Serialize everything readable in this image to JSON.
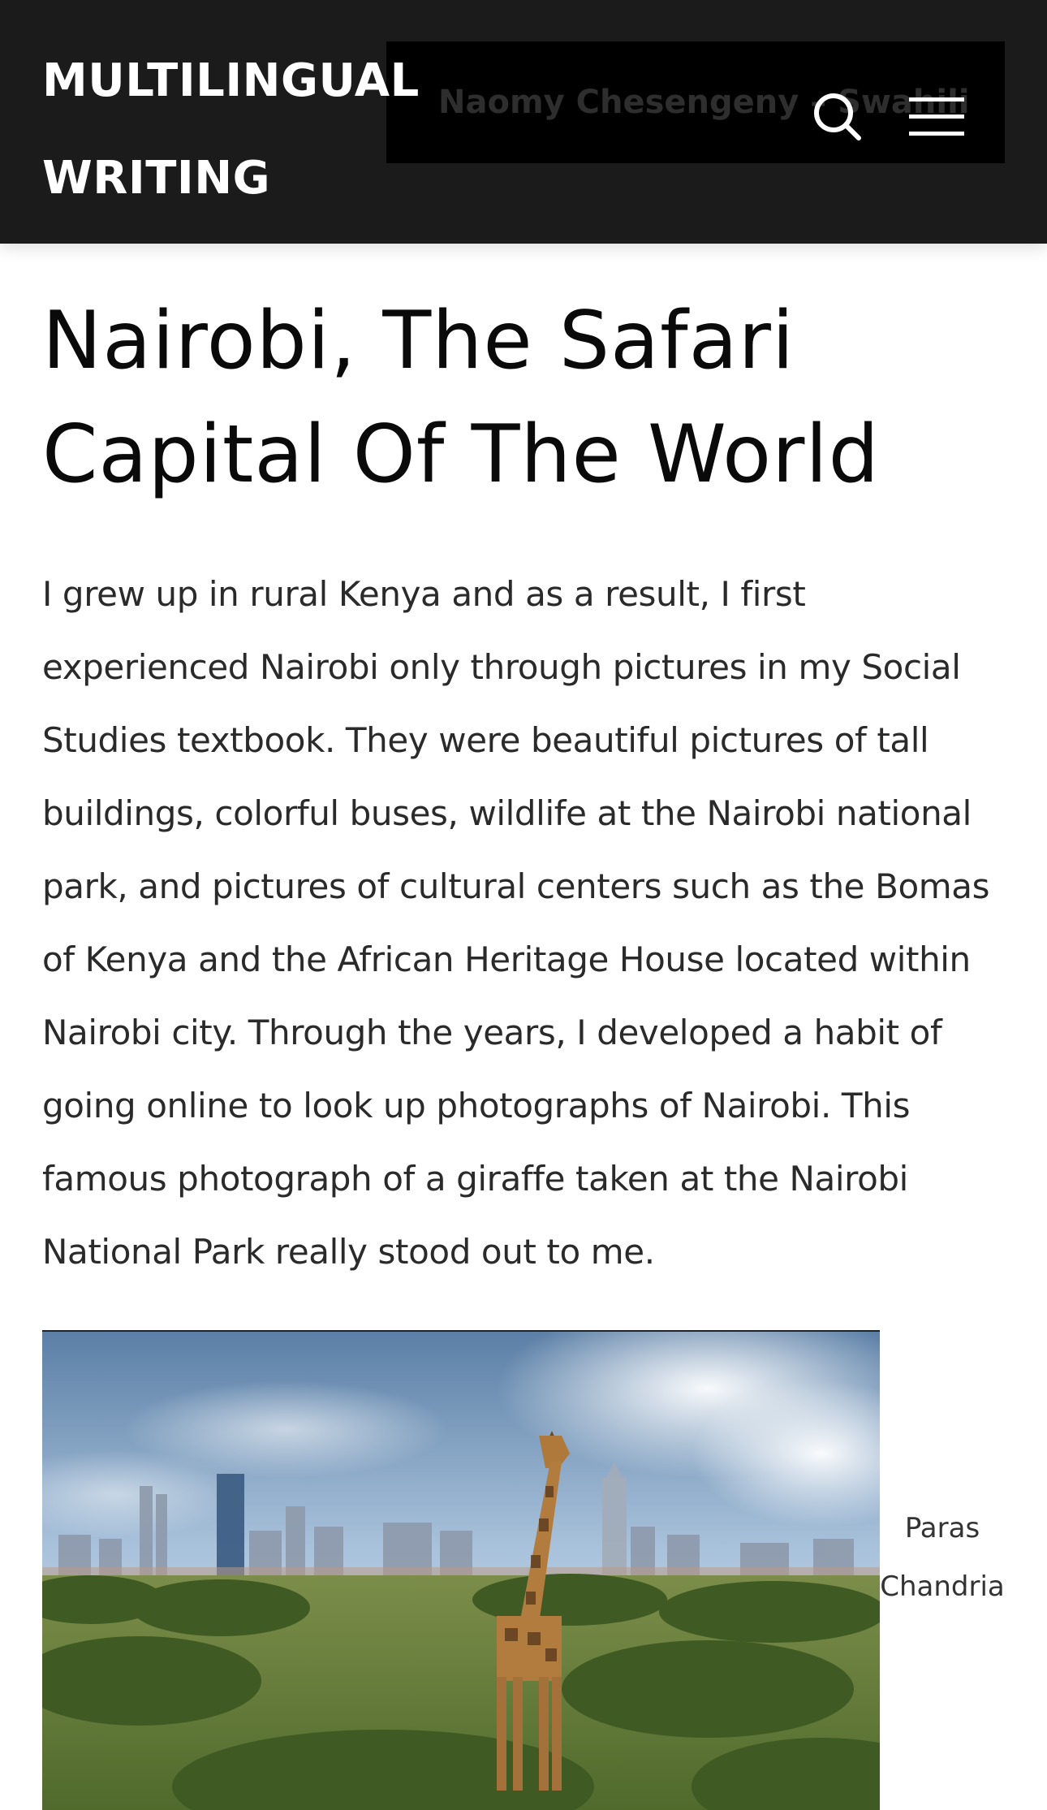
{
  "header": {
    "site_title_line1": "MULTILINGUAL",
    "site_title_line2": "WRITING",
    "panel_text": "Naomy Chesengeny – Swahili",
    "search_icon": "search-icon",
    "menu_icon": "hamburger-menu-icon"
  },
  "article": {
    "title": "Nairobi, The Safari Capital Of The World",
    "body_lines": [
      "I grew up in rural Kenya and as a result, I first",
      "experienced Nairobi only through pictures in my Social",
      "Studies textbook. They were beautiful pictures of tall",
      "buildings, colorful buses, wildlife at the Nairobi national",
      "park, and pictures of cultural centers such as the Bomas",
      "of Kenya and the African Heritage House located within",
      "Nairobi city. Through the years, I developed a habit of",
      "going online to look up photographs of Nairobi. This",
      "famous photograph of a giraffe taken at the Nairobi",
      "National Park really stood out to me."
    ]
  },
  "figure": {
    "caption_line1": "Paras",
    "caption_line2": "Chandria"
  },
  "colors": {
    "header_bg": "#1b1b1b",
    "panel_bg": "#000000",
    "title_text": "#0a0a0a",
    "body_text": "#2a2a2a"
  }
}
